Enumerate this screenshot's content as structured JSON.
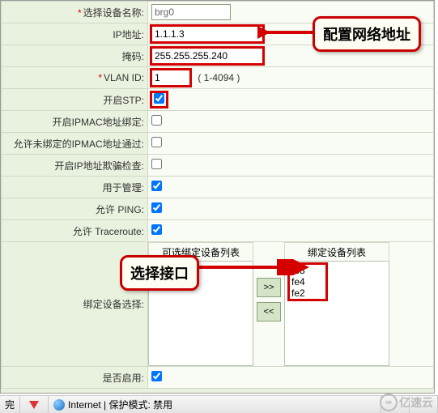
{
  "form": {
    "device_name": {
      "label": "选择设备名称:",
      "value": "brg0",
      "required": true
    },
    "ip": {
      "label": "IP地址:",
      "value": "1.1.1.3"
    },
    "mask": {
      "label": "掩码:",
      "value": "255.255.255.240"
    },
    "vlan": {
      "label": "VLAN ID:",
      "value": "1",
      "hint": "( 1-4094 )",
      "required": true
    },
    "stp": {
      "label": "开启STP:",
      "checked": true
    },
    "ipmac_bind": {
      "label": "开启IPMAC地址绑定:",
      "checked": false
    },
    "ipmac_pass": {
      "label": "允许未绑定的IPMAC地址通过:",
      "checked": false
    },
    "ip_spoof": {
      "label": "开启IP地址欺骗检查:",
      "checked": false
    },
    "for_manage": {
      "label": "用于管理:",
      "checked": true
    },
    "allow_ping": {
      "label": "允许 PING:",
      "checked": true
    },
    "allow_trace": {
      "label": "允许 Traceroute:",
      "checked": true
    },
    "bind_select": {
      "label": "绑定设备选择:"
    },
    "enabled": {
      "label": "是否启用:",
      "checked": true
    }
  },
  "lists": {
    "available_title": "可选绑定设备列表",
    "bound_title": "绑定设备列表",
    "available": [],
    "bound": [
      "fe3",
      "fe4",
      "fe2"
    ],
    "btn_add": ">>",
    "btn_remove": "<<"
  },
  "callouts": {
    "net_addr": "配置网络地址",
    "pick_if": "选择接口"
  },
  "statusbar": {
    "done": "完",
    "zone": "Internet | 保护模式: 禁用"
  },
  "watermark": "亿速云"
}
